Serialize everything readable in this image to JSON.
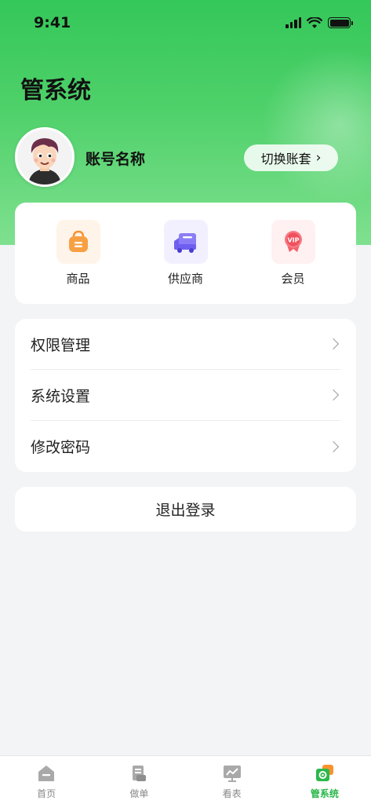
{
  "status_bar": {
    "time": "9:41"
  },
  "page": {
    "title": "管系统"
  },
  "account": {
    "name": "账号名称",
    "switch_label": "切换账套"
  },
  "quick_actions": [
    {
      "label": "商品",
      "icon": "shopping-bag-icon",
      "bg": "#fff4ea",
      "color": "#f7932f"
    },
    {
      "label": "供应商",
      "icon": "delivery-truck-icon",
      "bg": "#f2f0ff",
      "color": "#7160f2"
    },
    {
      "label": "会员",
      "icon": "vip-badge-icon",
      "bg": "#fff0f1",
      "color": "#f0505c"
    }
  ],
  "menu": [
    {
      "label": "权限管理"
    },
    {
      "label": "系统设置"
    },
    {
      "label": "修改密码"
    }
  ],
  "logout_label": "退出登录",
  "tabbar": {
    "items": [
      {
        "label": "首页",
        "icon": "home-icon",
        "active": false
      },
      {
        "label": "做单",
        "icon": "order-document-icon",
        "active": false
      },
      {
        "label": "看表",
        "icon": "chart-board-icon",
        "active": false
      },
      {
        "label": "管系统",
        "icon": "manage-system-icon",
        "active": true
      }
    ]
  },
  "colors": {
    "brand": "#34c759",
    "active_tab": "#2bb84b"
  }
}
